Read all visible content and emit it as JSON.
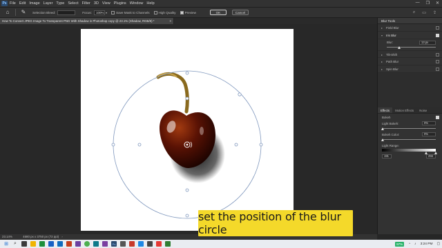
{
  "menu": {
    "app_logo": "Ps",
    "items": [
      "File",
      "Edit",
      "Image",
      "Layer",
      "Type",
      "Select",
      "Filter",
      "3D",
      "View",
      "Plugins",
      "Window",
      "Help"
    ],
    "window_controls": [
      "—",
      "❐",
      "✕"
    ]
  },
  "options_bar": {
    "selection_bleed_label": "Selection Bleed:",
    "focus_label": "Focus:",
    "focus_value": "100%",
    "save_mask_label": "Save Mask to Channels",
    "high_quality_label": "High Quality",
    "preview_label": "Preview",
    "preview_checked": true,
    "ok_label": "OK",
    "cancel_label": "Cancel"
  },
  "document": {
    "tab_title": "How To Convert JPEG Image To Transparent PNG With Shadow in Photoshop copy @ 23.1% (Shadow, RGB/8) *",
    "close_glyph": "×"
  },
  "status_bar": {
    "zoom": "23.14%",
    "doc_size": "4680 px x 3750 px (72 ppi)"
  },
  "panel": {
    "title": "Blur Tools",
    "filters": [
      {
        "label": "Field Blur",
        "checked": false
      },
      {
        "label": "Iris Blur",
        "checked": true
      },
      {
        "label": "Tilt-Shift",
        "checked": false
      },
      {
        "label": "Path Blur",
        "checked": false
      },
      {
        "label": "Spin Blur",
        "checked": false
      }
    ],
    "blur_label": "Blur:",
    "blur_value": "13 px",
    "effects_tabs": [
      "Effects",
      "Motion Effects",
      "Noise"
    ],
    "bokeh_label": "Bokeh",
    "bokeh_checked": true,
    "light_bokeh_label": "Light Bokeh:",
    "light_bokeh_value": "0%",
    "bokeh_color_label": "Bokeh Color:",
    "bokeh_color_value": "0%",
    "light_range_label": "Light Range:",
    "light_range_min": "191",
    "light_range_max": "255"
  },
  "caption": {
    "text": "set the position of the blur circle"
  },
  "taskbar": {
    "battery": "97%",
    "time": "3:24 PM"
  },
  "colors": {
    "caption_bg": "#f4d92a",
    "iris_circle": "#7f97bd"
  }
}
